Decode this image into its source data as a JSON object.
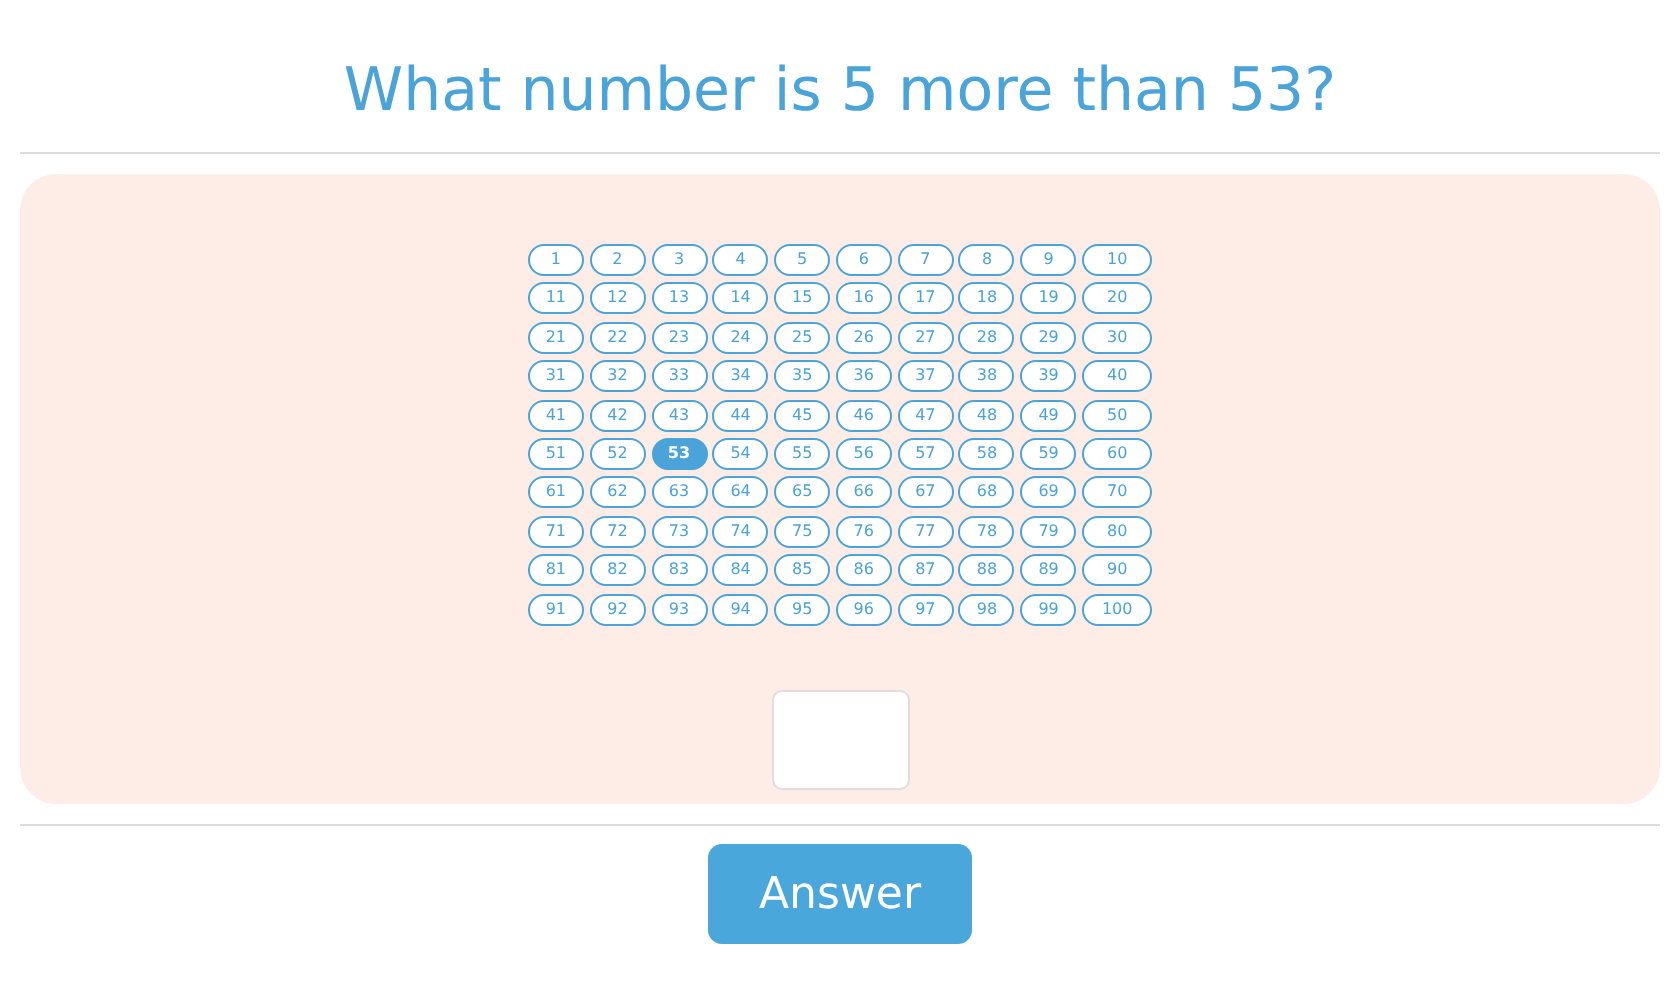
{
  "question": "What number is 5 more than 53?",
  "hundred_chart": {
    "rows": [
      [
        {
          "label": "1",
          "selected": false
        },
        {
          "label": "2",
          "selected": false
        },
        {
          "label": "3",
          "selected": false
        },
        {
          "label": "4",
          "selected": false
        },
        {
          "label": "5",
          "selected": false
        },
        {
          "label": "6",
          "selected": false
        },
        {
          "label": "7",
          "selected": false
        },
        {
          "label": "8",
          "selected": false
        },
        {
          "label": "9",
          "selected": false
        },
        {
          "label": "10",
          "selected": false
        }
      ],
      [
        {
          "label": "11",
          "selected": false
        },
        {
          "label": "12",
          "selected": false
        },
        {
          "label": "13",
          "selected": false
        },
        {
          "label": "14",
          "selected": false
        },
        {
          "label": "15",
          "selected": false
        },
        {
          "label": "16",
          "selected": false
        },
        {
          "label": "17",
          "selected": false
        },
        {
          "label": "18",
          "selected": false
        },
        {
          "label": "19",
          "selected": false
        },
        {
          "label": "20",
          "selected": false
        }
      ],
      [
        {
          "label": "21",
          "selected": false
        },
        {
          "label": "22",
          "selected": false
        },
        {
          "label": "23",
          "selected": false
        },
        {
          "label": "24",
          "selected": false
        },
        {
          "label": "25",
          "selected": false
        },
        {
          "label": "26",
          "selected": false
        },
        {
          "label": "27",
          "selected": false
        },
        {
          "label": "28",
          "selected": false
        },
        {
          "label": "29",
          "selected": false
        },
        {
          "label": "30",
          "selected": false
        }
      ],
      [
        {
          "label": "31",
          "selected": false
        },
        {
          "label": "32",
          "selected": false
        },
        {
          "label": "33",
          "selected": false
        },
        {
          "label": "34",
          "selected": false
        },
        {
          "label": "35",
          "selected": false
        },
        {
          "label": "36",
          "selected": false
        },
        {
          "label": "37",
          "selected": false
        },
        {
          "label": "38",
          "selected": false
        },
        {
          "label": "39",
          "selected": false
        },
        {
          "label": "40",
          "selected": false
        }
      ],
      [
        {
          "label": "41",
          "selected": false
        },
        {
          "label": "42",
          "selected": false
        },
        {
          "label": "43",
          "selected": false
        },
        {
          "label": "44",
          "selected": false
        },
        {
          "label": "45",
          "selected": false
        },
        {
          "label": "46",
          "selected": false
        },
        {
          "label": "47",
          "selected": false
        },
        {
          "label": "48",
          "selected": false
        },
        {
          "label": "49",
          "selected": false
        },
        {
          "label": "50",
          "selected": false
        }
      ],
      [
        {
          "label": "51",
          "selected": false
        },
        {
          "label": "52",
          "selected": false
        },
        {
          "label": "53",
          "selected": true
        },
        {
          "label": "54",
          "selected": false
        },
        {
          "label": "55",
          "selected": false
        },
        {
          "label": "56",
          "selected": false
        },
        {
          "label": "57",
          "selected": false
        },
        {
          "label": "58",
          "selected": false
        },
        {
          "label": "59",
          "selected": false
        },
        {
          "label": "60",
          "selected": false
        }
      ],
      [
        {
          "label": "61",
          "selected": false
        },
        {
          "label": "62",
          "selected": false
        },
        {
          "label": "63",
          "selected": false
        },
        {
          "label": "64",
          "selected": false
        },
        {
          "label": "65",
          "selected": false
        },
        {
          "label": "66",
          "selected": false
        },
        {
          "label": "67",
          "selected": false
        },
        {
          "label": "68",
          "selected": false
        },
        {
          "label": "69",
          "selected": false
        },
        {
          "label": "70",
          "selected": false
        }
      ],
      [
        {
          "label": "71",
          "selected": false
        },
        {
          "label": "72",
          "selected": false
        },
        {
          "label": "73",
          "selected": false
        },
        {
          "label": "74",
          "selected": false
        },
        {
          "label": "75",
          "selected": false
        },
        {
          "label": "76",
          "selected": false
        },
        {
          "label": "77",
          "selected": false
        },
        {
          "label": "78",
          "selected": false
        },
        {
          "label": "79",
          "selected": false
        },
        {
          "label": "80",
          "selected": false
        }
      ],
      [
        {
          "label": "81",
          "selected": false
        },
        {
          "label": "82",
          "selected": false
        },
        {
          "label": "83",
          "selected": false
        },
        {
          "label": "84",
          "selected": false
        },
        {
          "label": "85",
          "selected": false
        },
        {
          "label": "86",
          "selected": false
        },
        {
          "label": "87",
          "selected": false
        },
        {
          "label": "88",
          "selected": false
        },
        {
          "label": "89",
          "selected": false
        },
        {
          "label": "90",
          "selected": false
        }
      ],
      [
        {
          "label": "91",
          "selected": false
        },
        {
          "label": "92",
          "selected": false
        },
        {
          "label": "93",
          "selected": false
        },
        {
          "label": "94",
          "selected": false
        },
        {
          "label": "95",
          "selected": false
        },
        {
          "label": "96",
          "selected": false
        },
        {
          "label": "97",
          "selected": false
        },
        {
          "label": "98",
          "selected": false
        },
        {
          "label": "99",
          "selected": false
        },
        {
          "label": "100",
          "selected": false
        }
      ]
    ]
  },
  "answer_button": "Answer"
}
